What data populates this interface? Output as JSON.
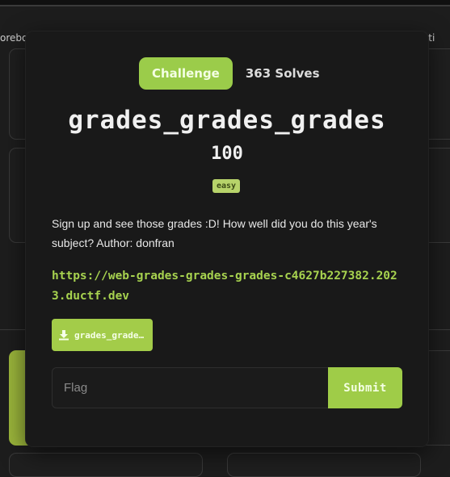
{
  "background": {
    "left_label": "orebo",
    "right_label": "icati"
  },
  "modal": {
    "tab_challenge": "Challenge",
    "solves": "363 Solves",
    "title": "grades_grades_grades",
    "points": "100",
    "difficulty": "easy",
    "description": "Sign up and see those grades :D! How well did you do this year's subject? Author: donfran",
    "link": "https://web-grades-grades-grades-c4627b227382.2023.ductf.dev",
    "file_name": "grades_grades_grades.zip",
    "flag_placeholder": "Flag",
    "submit_label": "Submit"
  },
  "colors": {
    "accent": "#9fcc48",
    "background": "#1d1d1d",
    "modal": "#191919"
  }
}
